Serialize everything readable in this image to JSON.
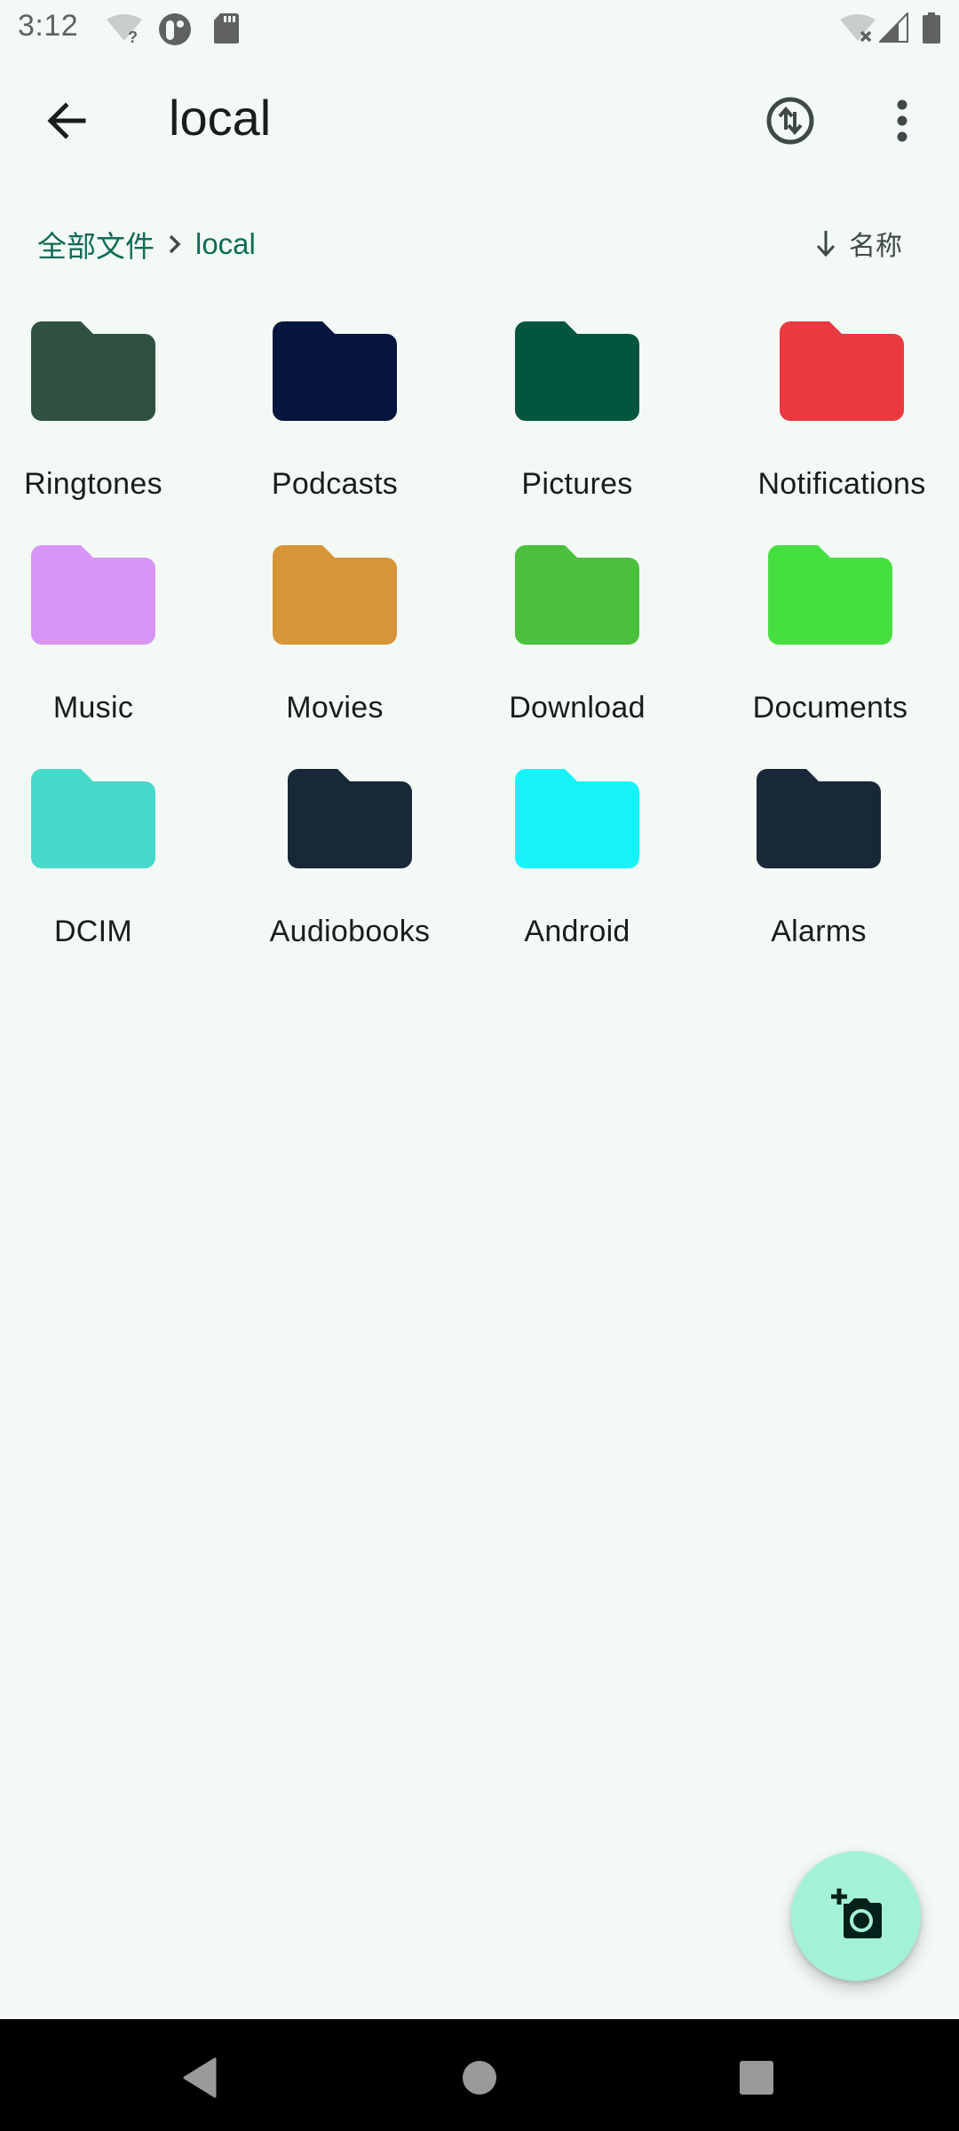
{
  "status_bar": {
    "time": "3:12",
    "left_icons": [
      "wifi-unknown-icon",
      "app-notification-icon",
      "sd-card-icon"
    ],
    "right_icons": [
      "wifi-off-icon",
      "cell-signal-icon",
      "battery-icon"
    ]
  },
  "app_bar": {
    "title": "local",
    "back_icon": "arrow-back-icon",
    "actions": [
      "sync-icon",
      "more-vert-icon"
    ]
  },
  "breadcrumb": {
    "items": [
      "全部文件",
      "local"
    ],
    "separator_icon": "chevron-right-icon"
  },
  "sort": {
    "direction_icon": "arrow-down-icon",
    "label": "名称"
  },
  "folders": [
    {
      "name": "Ringtones",
      "color": "#2f5141"
    },
    {
      "name": "Podcasts",
      "color": "#06153d"
    },
    {
      "name": "Pictures",
      "color": "#03563d"
    },
    {
      "name": "Notifications",
      "color": "#e83a3f"
    },
    {
      "name": "Music",
      "color": "#d895f5"
    },
    {
      "name": "Movies",
      "color": "#d79537"
    },
    {
      "name": "Download",
      "color": "#4ac03d"
    },
    {
      "name": "Documents",
      "color": "#45e040"
    },
    {
      "name": "DCIM",
      "color": "#46d8c8"
    },
    {
      "name": "Audiobooks",
      "color": "#182838"
    },
    {
      "name": "Android",
      "color": "#17f3fb"
    },
    {
      "name": "Alarms",
      "color": "#182838"
    }
  ],
  "fab": {
    "icon": "add-a-photo-icon",
    "background": "#a4f2d6"
  },
  "nav_bar": {
    "buttons": [
      "back-triangle-icon",
      "home-circle-icon",
      "recents-square-icon"
    ]
  },
  "colors": {
    "background": "#f3faf6",
    "accent": "#0e6b55"
  }
}
